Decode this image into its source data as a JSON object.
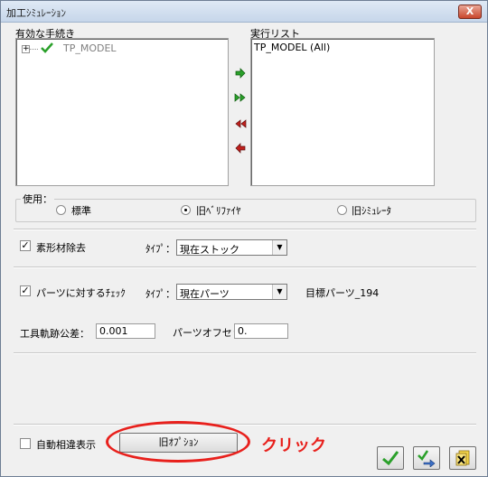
{
  "window": {
    "title": "加工ｼﾐｭﾚｰｼｮﾝ",
    "close_glyph": "X"
  },
  "left_panel": {
    "label": "有効な手続き",
    "tree_item": "TP_MODEL",
    "expand_glyph": "+"
  },
  "right_panel": {
    "label": "実行リスト",
    "items": [
      "TP_MODEL (All)"
    ]
  },
  "transfer_buttons": [
    "add-one",
    "add-all",
    "remove-all",
    "remove-one"
  ],
  "usage": {
    "legend": "使用：",
    "options": [
      {
        "label": "標準",
        "selected": false
      },
      {
        "label": "旧ﾍﾞﾘﾌｧｲﾔ",
        "selected": true
      },
      {
        "label": "旧ｼﾐｭﾚｰﾀ",
        "selected": false
      }
    ]
  },
  "stock_removal": {
    "checkbox_label": "素形材除去",
    "checked": true,
    "type_label": "ﾀｲﾌﾟ：",
    "type_value": "現在ストック"
  },
  "part_check": {
    "checkbox_label": "パーツに対するﾁｪｯｸ",
    "checked": true,
    "type_label": "ﾀｲﾌﾟ：",
    "type_value": "現在パーツ",
    "target_label": "目標パーツ_194"
  },
  "tolerance": {
    "path_label": "工具軌跡公差：",
    "path_value": "0.001",
    "offset_label": "パーツオフセット",
    "offset_value": "0."
  },
  "footer": {
    "auto_diff_label": "自動相違表示",
    "auto_diff_checked": false,
    "old_options_button": "旧ｵﾌﾟｼｮﾝ",
    "annotation": "クリック"
  },
  "colors": {
    "accent_red": "#e8201c",
    "arrow_green": "#2aa02a",
    "arrow_red": "#c0201c"
  }
}
